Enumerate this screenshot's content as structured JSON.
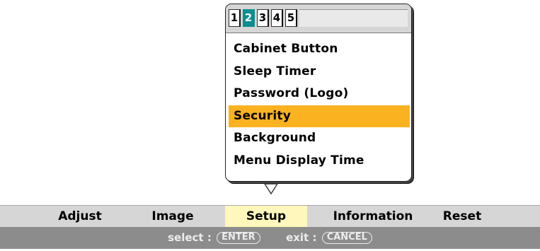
{
  "submenu": {
    "tabs": [
      {
        "label": "1",
        "active": false
      },
      {
        "label": "2",
        "active": true
      },
      {
        "label": "3",
        "active": false
      },
      {
        "label": "4",
        "active": false
      },
      {
        "label": "5",
        "active": false
      }
    ],
    "items": [
      {
        "label": "Cabinet Button",
        "selected": false
      },
      {
        "label": "Sleep Timer",
        "selected": false
      },
      {
        "label": "Password (Logo)",
        "selected": false
      },
      {
        "label": "Security",
        "selected": true
      },
      {
        "label": "Background",
        "selected": false
      },
      {
        "label": "Menu Display Time",
        "selected": false
      }
    ],
    "more_indicator_icon": "down-triangle-icon"
  },
  "mainmenu": {
    "items": [
      {
        "label": "Adjust",
        "active": false
      },
      {
        "label": "Image",
        "active": false
      },
      {
        "label": "Setup",
        "active": true
      },
      {
        "label": "Information",
        "active": false
      },
      {
        "label": "Reset",
        "active": false
      }
    ]
  },
  "hint": {
    "select_label": "select :",
    "select_key": "ENTER",
    "exit_label": "exit :",
    "exit_key": "CANCEL"
  },
  "colors": {
    "active_tab": "#0b8e91",
    "selected_item": "#fbb221",
    "active_menu": "#fff7bc",
    "menubar": "#d6d6d6",
    "hintbar": "#8c8c8c"
  }
}
